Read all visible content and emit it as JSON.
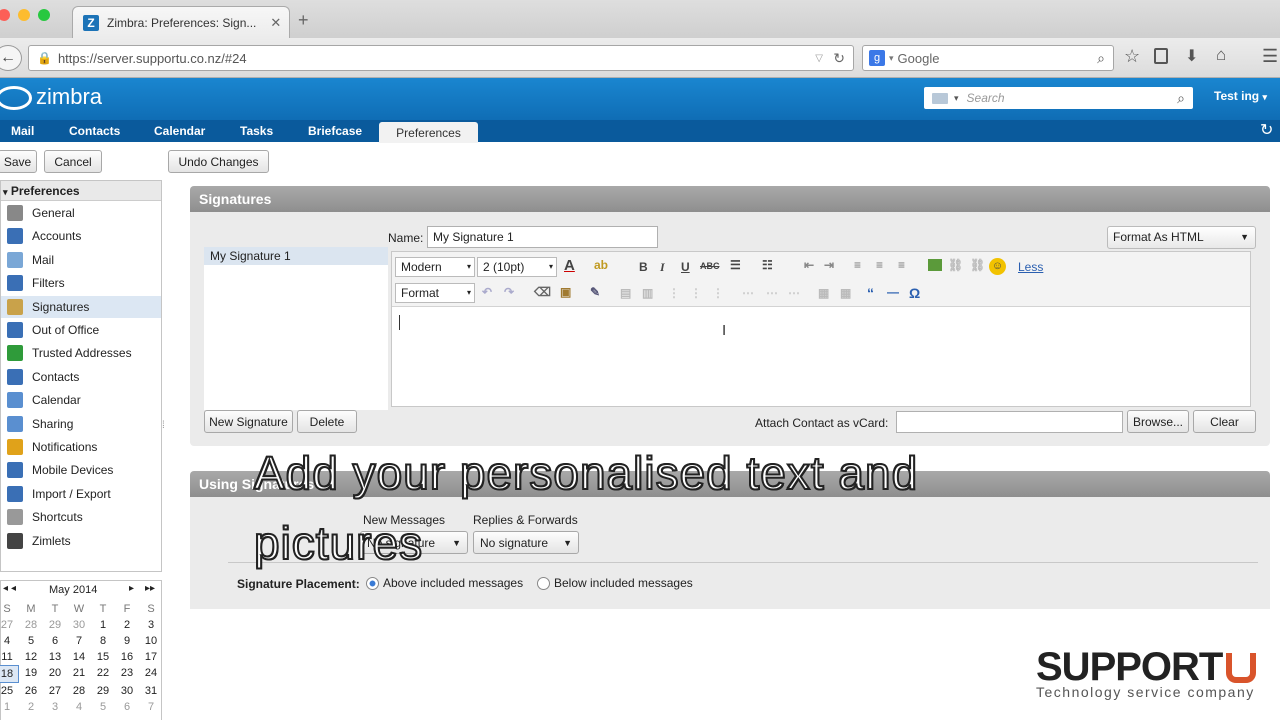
{
  "browser": {
    "tab_title": "Zimbra: Preferences: Sign...",
    "url": "https://server.supportu.co.nz/#24",
    "search_engine": "Google"
  },
  "app": {
    "logo_text": "zimbra",
    "search_placeholder": "Search",
    "user": "Test ing",
    "nav": [
      "Mail",
      "Contacts",
      "Calendar",
      "Tasks",
      "Briefcase",
      "Preferences"
    ],
    "nav_active": "Preferences"
  },
  "toolbar": {
    "save": "Save",
    "cancel": "Cancel",
    "undo": "Undo Changes"
  },
  "sidebar": {
    "header": "Preferences",
    "items": [
      {
        "label": "General",
        "icon": "gear-icon",
        "color": "#888"
      },
      {
        "label": "Accounts",
        "icon": "accounts-icon",
        "color": "#3a6fb5"
      },
      {
        "label": "Mail",
        "icon": "mail-icon",
        "color": "#7aa7d6"
      },
      {
        "label": "Filters",
        "icon": "filter-icon",
        "color": "#3a6fb5"
      },
      {
        "label": "Signatures",
        "icon": "signature-icon",
        "color": "#c9a24a"
      },
      {
        "label": "Out of Office",
        "icon": "out-of-office-icon",
        "color": "#3a6fb5"
      },
      {
        "label": "Trusted Addresses",
        "icon": "shield-icon",
        "color": "#2f9b3a"
      },
      {
        "label": "Contacts",
        "icon": "contacts-icon",
        "color": "#3a6fb5"
      },
      {
        "label": "Calendar",
        "icon": "calendar-icon",
        "color": "#5a8fd0"
      },
      {
        "label": "Sharing",
        "icon": "sharing-icon",
        "color": "#5a8fd0"
      },
      {
        "label": "Notifications",
        "icon": "bell-icon",
        "color": "#e0a21a"
      },
      {
        "label": "Mobile Devices",
        "icon": "mobile-icon",
        "color": "#3a6fb5"
      },
      {
        "label": "Import / Export",
        "icon": "import-export-icon",
        "color": "#3a6fb5"
      },
      {
        "label": "Shortcuts",
        "icon": "shortcuts-icon",
        "color": "#999"
      },
      {
        "label": "Zimlets",
        "icon": "zimlets-icon",
        "color": "#444"
      }
    ],
    "selected": "Signatures"
  },
  "calendar": {
    "month": "May 2014",
    "weekdays": [
      "S",
      "M",
      "T",
      "W",
      "T",
      "F",
      "S"
    ],
    "days": [
      "27",
      "28",
      "29",
      "30",
      "1",
      "2",
      "3",
      "4",
      "5",
      "6",
      "7",
      "8",
      "9",
      "10",
      "11",
      "12",
      "13",
      "14",
      "15",
      "16",
      "17",
      "18",
      "19",
      "20",
      "21",
      "22",
      "23",
      "24",
      "25",
      "26",
      "27",
      "28",
      "29",
      "30",
      "31",
      "1",
      "2",
      "3",
      "4",
      "5",
      "6",
      "7"
    ],
    "today": "18"
  },
  "signatures": {
    "title": "Signatures",
    "name_label": "Name:",
    "name_value": "My Signature 1",
    "list": [
      "My Signature 1"
    ],
    "format_select": "Format As HTML",
    "font_family": "Modern",
    "font_size": "2 (10pt)",
    "block_format": "Format",
    "less_link": "Less",
    "new_button": "New Signature",
    "delete_button": "Delete",
    "attach_label": "Attach Contact as vCard:",
    "browse_button": "Browse...",
    "clear_button": "Clear"
  },
  "using": {
    "title": "Using Signatures",
    "new_messages_label": "New Messages",
    "new_messages_value": "No signature",
    "replies_label": "Replies & Forwards",
    "replies_value": "No signature",
    "placement_label": "Signature Placement:",
    "placement_options": [
      "Above included messages",
      "Below included messages"
    ],
    "placement_selected": "Above included messages"
  },
  "caption": {
    "line1": "Add your personalised text and",
    "line2": "pictures"
  },
  "watermark": {
    "brand": "SUPPORT",
    "tagline": "Technology service company",
    "color": "#d9542b"
  }
}
